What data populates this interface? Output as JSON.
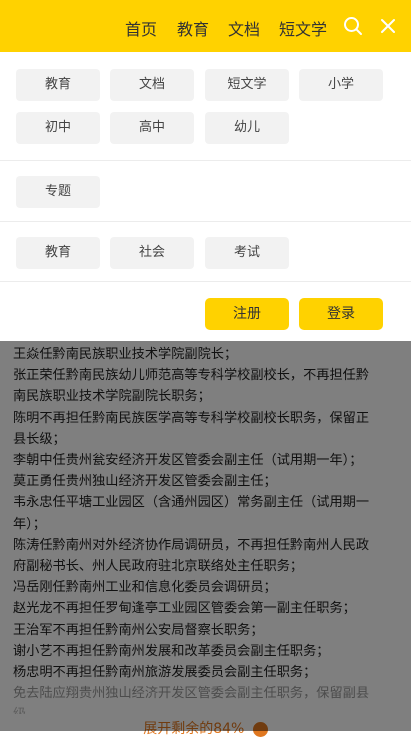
{
  "header": {
    "nav": [
      "首页",
      "教育",
      "文档",
      "短文学"
    ]
  },
  "panel": {
    "row1": [
      "教育",
      "文档",
      "短文学",
      "小学"
    ],
    "row2": [
      "初中",
      "高中",
      "幼儿"
    ],
    "topic": "专题",
    "row3": [
      "教育",
      "社会",
      "考试"
    ],
    "register": "注册",
    "login": "登录"
  },
  "article": {
    "lines": [
      "王焱任黔南民族职业技术学院副院长；",
      "张正荣任黔南民族幼儿师范高等专科学校副校长，不再担任黔",
      "南民族职业技术学院副院长职务；",
      "陈明不再担任黔南民族医学高等专科学校副校长职务，保留正",
      "县长级；",
      "李朝中任贵州瓮安经济开发区管委会副主任（试用期一年）；",
      "莫正勇任贵州独山经济开发区管委会副主任；",
      "韦永忠任平塘工业园区（含通州园区）常务副主任（试用期一",
      "年）；",
      "陈涛任黔南州对外经济协作局调研员，不再担任黔南州人民政",
      "府副秘书长、州人民政府驻北京联络处主任职务；",
      "冯岳刚任黔南州工业和信息化委员会调研员；",
      "赵光龙不再担任罗甸逢亭工业园区管委会第一副主任职务；",
      "王治军不再担任黔南州公安局督察长职务；",
      "谢小艺不再担任黔南州发展和改革委员会副主任职务；",
      "杨忠明不再担任黔南州旅游发展委员会副主任职务；",
      "免去陆应翔贵州独山经济开发区管委会副主任职务，保留副县",
      "级。"
    ],
    "expand": "展开剩余的84%"
  }
}
